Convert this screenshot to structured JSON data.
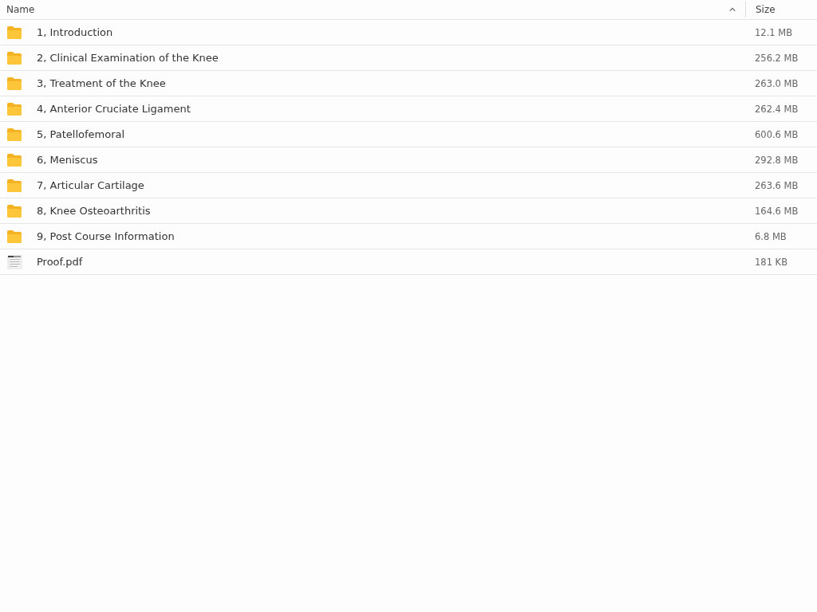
{
  "columns": {
    "name": "Name",
    "size": "Size",
    "sorted_ascending": true
  },
  "rows": [
    {
      "kind": "folder",
      "name": "1, Introduction",
      "size": "12.1 MB"
    },
    {
      "kind": "folder",
      "name": "2, Clinical Examination of the Knee",
      "size": "256.2 MB"
    },
    {
      "kind": "folder",
      "name": "3, Treatment of the Knee",
      "size": "263.0 MB"
    },
    {
      "kind": "folder",
      "name": "4, Anterior Cruciate Ligament",
      "size": "262.4 MB"
    },
    {
      "kind": "folder",
      "name": "5, Patellofemoral",
      "size": "600.6 MB"
    },
    {
      "kind": "folder",
      "name": "6, Meniscus",
      "size": "292.8 MB"
    },
    {
      "kind": "folder",
      "name": "7, Articular Cartilage",
      "size": "263.6 MB"
    },
    {
      "kind": "folder",
      "name": "8, Knee Osteoarthritis",
      "size": "164.6 MB"
    },
    {
      "kind": "folder",
      "name": "9, Post Course Information",
      "size": "6.8 MB"
    },
    {
      "kind": "file",
      "name": "Proof.pdf",
      "size": "181 KB"
    }
  ]
}
